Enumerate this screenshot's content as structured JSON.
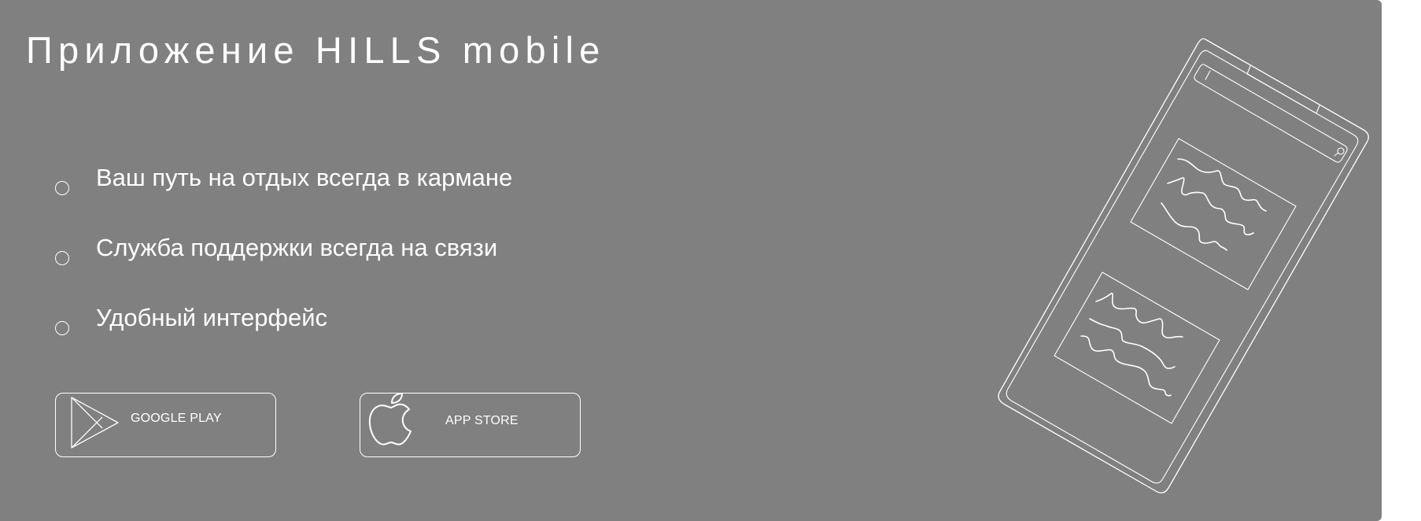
{
  "banner": {
    "title": "Приложение HILLS mobile",
    "features": [
      {
        "label": "Ваш путь на отдых всегда в кармане"
      },
      {
        "label": "Служба поддержки всегда на связи"
      },
      {
        "label": "Удобный интерфейс"
      }
    ],
    "buttons": {
      "google_play": {
        "label": "GOOGLE PLAY",
        "icon": "google-play-icon"
      },
      "app_store": {
        "label": "APP STORE",
        "icon": "apple-icon"
      }
    },
    "illustration": {
      "icon": "phone-illustration"
    }
  },
  "colors": {
    "background": "#808080",
    "foreground": "#ffffff",
    "page": "#ffffff"
  }
}
